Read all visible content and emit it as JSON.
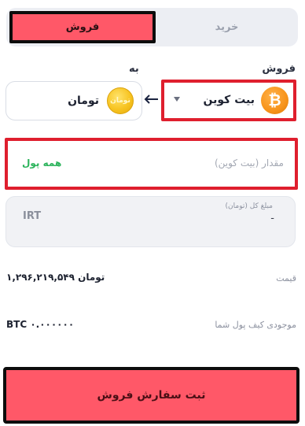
{
  "tabs": {
    "sell_label": "فروش",
    "buy_label": "خرید",
    "active": "sell"
  },
  "exchange": {
    "from_label": "فروش",
    "to_label": "به",
    "from_currency": {
      "name": "بیت کوین",
      "icon": "bitcoin-icon",
      "symbol": "₿"
    },
    "to_currency": {
      "name": "تومان",
      "icon": "toman-coin-icon",
      "symbol": "تومان"
    }
  },
  "amount": {
    "placeholder": "مقدار (بیت کوین)",
    "all_money_label": "همه پول"
  },
  "total": {
    "label": "مبلغ کل (تومان)",
    "value": "-",
    "unit": "IRT"
  },
  "price": {
    "label": "قیمت",
    "value": "۱,۲۹۶,۲۱۹,۵۴۹ تومان"
  },
  "wallet": {
    "label": "موجودی کیف پول شما",
    "value": "BTC ۰.۰۰۰۰۰۰"
  },
  "submit": {
    "label": "ثبت سفارش فروش"
  },
  "colors": {
    "accent": "#ff5868",
    "highlight_border": "#df1f2e",
    "success": "#2bb35b",
    "bitcoin": "#f7931a",
    "toman": "#f7c422"
  }
}
